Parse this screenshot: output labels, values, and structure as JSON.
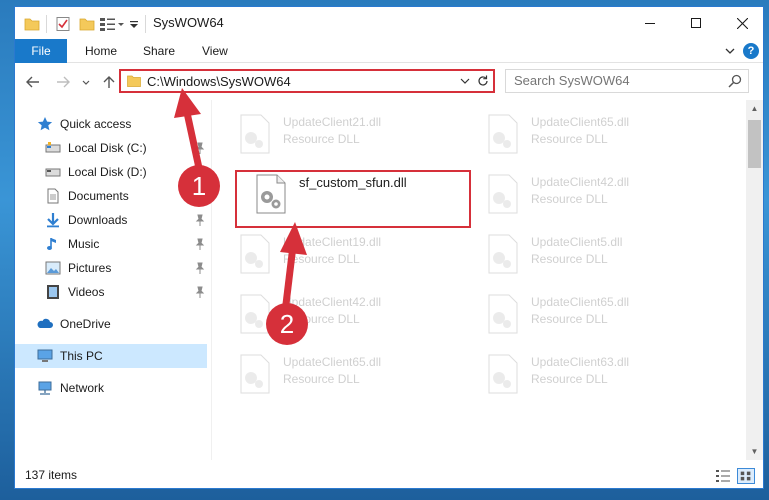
{
  "window": {
    "title": "SysWOW64",
    "controls": {
      "minimize": "─",
      "maximize": "☐",
      "close": "✕"
    }
  },
  "ribbon": {
    "tabs": [
      {
        "label": "File",
        "active": true
      },
      {
        "label": "Home"
      },
      {
        "label": "Share"
      },
      {
        "label": "View"
      }
    ],
    "help": "?"
  },
  "address_bar": {
    "path": "C:\\Windows\\SysWOW64"
  },
  "search": {
    "placeholder": "Search SysWOW64"
  },
  "sidebar": {
    "items": [
      {
        "label": "Quick access",
        "icon": "star-icon"
      },
      {
        "label": "Local Disk (C:)",
        "icon": "drive-icon",
        "pinned": true
      },
      {
        "label": "Local Disk (D:)",
        "icon": "drive-icon",
        "pinned": true
      },
      {
        "label": "Documents",
        "icon": "documents-icon",
        "pinned": true
      },
      {
        "label": "Downloads",
        "icon": "download-icon",
        "pinned": true
      },
      {
        "label": "Music",
        "icon": "music-icon",
        "pinned": true
      },
      {
        "label": "Pictures",
        "icon": "pictures-icon",
        "pinned": true
      },
      {
        "label": "Videos",
        "icon": "videos-icon",
        "pinned": true
      },
      {
        "label": "OneDrive",
        "icon": "cloud-icon"
      },
      {
        "label": "This PC",
        "icon": "computer-icon",
        "selected": true
      },
      {
        "label": "Network",
        "icon": "network-icon"
      }
    ]
  },
  "files": [
    {
      "name": "UpdateClient21.dll",
      "type": "Resource DLL",
      "faded": true
    },
    {
      "name": "UpdateClient65.dll",
      "type": "Resource DLL",
      "faded": true
    },
    {
      "name": "sf_custom_sfun.dll",
      "type": "",
      "faded": false,
      "highlighted": true
    },
    {
      "name": "UpdateClient42.dll",
      "type": "Resource DLL",
      "faded": true
    },
    {
      "name": "UpdateClient19.dll",
      "type": "Resource DLL",
      "faded": true
    },
    {
      "name": "UpdateClient5.dll",
      "type": "Resource DLL",
      "faded": true
    },
    {
      "name": "UpdateClient42.dll",
      "type": "Resource DLL",
      "faded": true
    },
    {
      "name": "UpdateClient65.dll",
      "type": "Resource DLL",
      "faded": true
    },
    {
      "name": "UpdateClient65.dll",
      "type": "Resource DLL",
      "faded": true
    },
    {
      "name": "UpdateClient63.dll",
      "type": "Resource DLL",
      "faded": true
    }
  ],
  "status": {
    "item_count": "137 items"
  },
  "annotations": {
    "step1": "1",
    "step2": "2",
    "color": "#d6303a"
  },
  "colors": {
    "accent": "#1979ca",
    "selection": "#cce8ff",
    "highlight": "#d6303a"
  }
}
